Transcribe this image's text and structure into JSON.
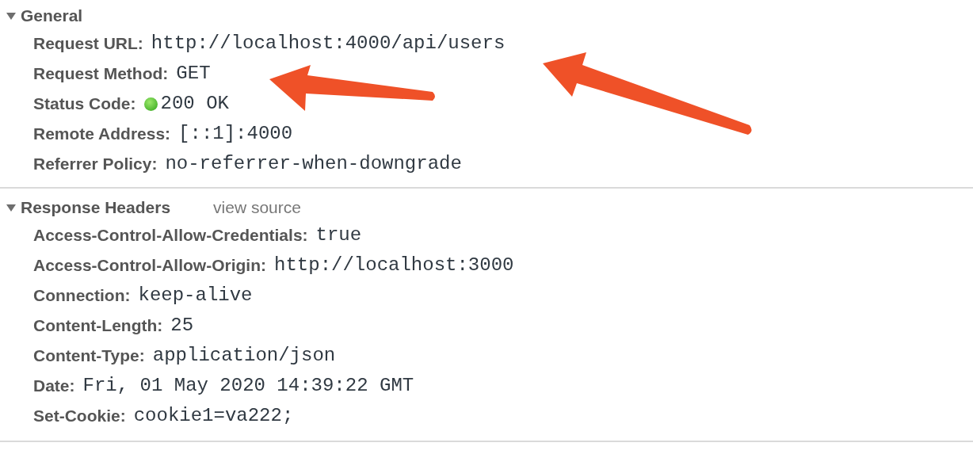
{
  "sections": [
    {
      "title": "General",
      "expanded": true,
      "rows": [
        {
          "kind": "text",
          "name": "Request URL:",
          "value": "http://localhost:4000/api/users"
        },
        {
          "kind": "text",
          "name": "Request Method:",
          "value": "GET"
        },
        {
          "kind": "status",
          "name": "Status Code:",
          "value": "200 OK"
        },
        {
          "kind": "text",
          "name": "Remote Address:",
          "value": "[::1]:4000"
        },
        {
          "kind": "text",
          "name": "Referrer Policy:",
          "value": "no-referrer-when-downgrade"
        }
      ]
    },
    {
      "title": "Response Headers",
      "expanded": true,
      "link": "view source",
      "rows": [
        {
          "kind": "text",
          "name": "Access-Control-Allow-Credentials:",
          "value": "true"
        },
        {
          "kind": "text",
          "name": "Access-Control-Allow-Origin:",
          "value": "http://localhost:3000"
        },
        {
          "kind": "text",
          "name": "Connection:",
          "value": "keep-alive"
        },
        {
          "kind": "text",
          "name": "Content-Length:",
          "value": "25"
        },
        {
          "kind": "text",
          "name": "Content-Type:",
          "value": "application/json"
        },
        {
          "kind": "text",
          "name": "Date:",
          "value": "Fri, 01 May 2020 14:39:22 GMT"
        },
        {
          "kind": "text",
          "name": "Set-Cookie:",
          "value": "cookie1=va222;"
        }
      ]
    }
  ]
}
